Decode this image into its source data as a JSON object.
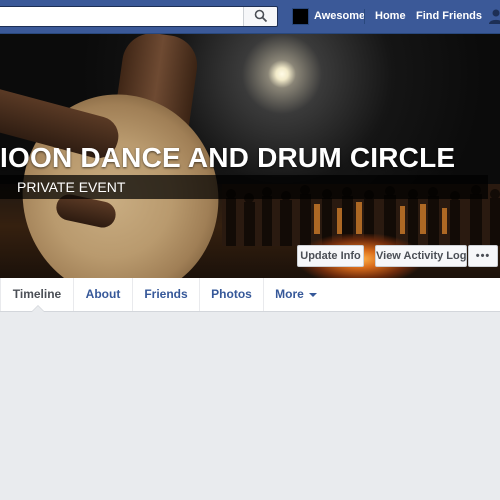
{
  "topbar": {
    "search": {
      "placeholder": "",
      "value": "",
      "icon": "search-icon"
    },
    "profile_name": "Awesome",
    "nav": {
      "home": "Home",
      "find_friends": "Find Friends"
    },
    "friend_requests_icon": "friend-requests-icon"
  },
  "cover": {
    "title": "IOON DANCE AND DRUM CIRCLE",
    "event_type": "PRIVATE EVENT",
    "buttons": {
      "update_info": "Update Info",
      "view_activity_log": "View Activity Log",
      "more": "•••"
    }
  },
  "tabs": {
    "active": "Timeline",
    "items": [
      {
        "label": "Timeline"
      },
      {
        "label": "About"
      },
      {
        "label": "Friends"
      },
      {
        "label": "Photos"
      },
      {
        "label": "More"
      }
    ]
  },
  "colors": {
    "brand_blue": "#3b5998",
    "link_blue": "#365899",
    "page_background": "#e9ebee"
  }
}
